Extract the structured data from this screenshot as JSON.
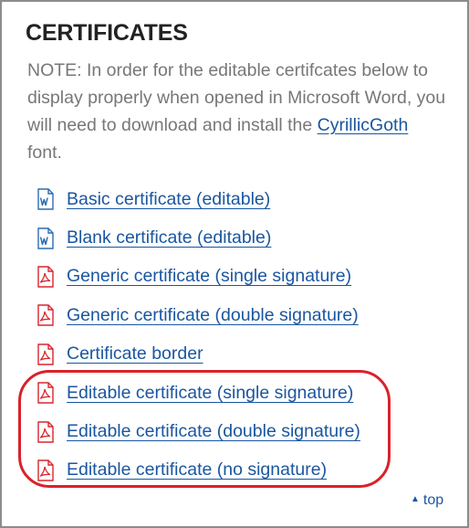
{
  "section": {
    "title": "CERTIFICATES",
    "note_prefix": "NOTE: In order for the editable certifcates below to display properly when opened in Microsoft Word, you will need to download and install the ",
    "note_link": "CyrillicGoth",
    "note_suffix": " font."
  },
  "links": [
    {
      "label": "Basic certificate (editable)",
      "icon": "word-document-icon"
    },
    {
      "label": "Blank certificate (editable)",
      "icon": "word-document-icon"
    },
    {
      "label": "Generic certificate (single signature)",
      "icon": "pdf-icon"
    },
    {
      "label": "Generic certificate (double signature)",
      "icon": "pdf-icon"
    },
    {
      "label": "Certificate border",
      "icon": "pdf-icon"
    },
    {
      "label": "Editable certificate (single signature)",
      "icon": "pdf-icon"
    },
    {
      "label": "Editable certificate (double signature)",
      "icon": "pdf-icon"
    },
    {
      "label": "Editable certificate (no signature)",
      "icon": "pdf-icon"
    }
  ],
  "footer": {
    "top_label": "top",
    "top_icon": "caret-up-icon"
  },
  "colors": {
    "link": "#1a56a0",
    "highlight": "#d9222a",
    "pdf_icon": "#d9262e",
    "word_icon": "#2d6bb3"
  }
}
